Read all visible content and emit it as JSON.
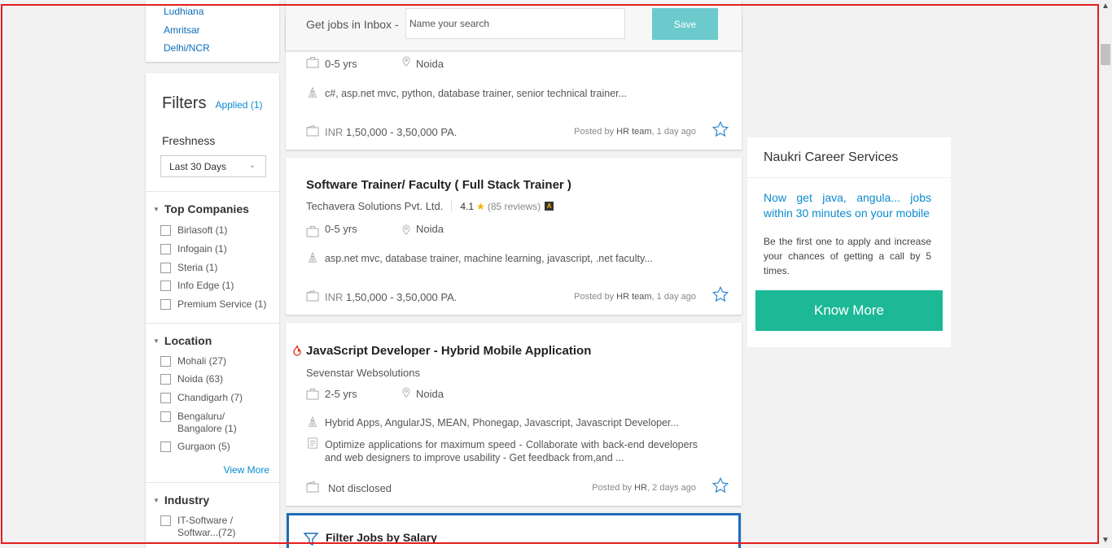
{
  "cities": [
    "Ludhiana",
    "Amritsar",
    "Delhi/NCR"
  ],
  "filters": {
    "title": "Filters",
    "applied": "Applied (1)",
    "freshness_label": "Freshness",
    "freshness_value": "Last 30 Days",
    "top_companies": {
      "title": "Top Companies",
      "options": [
        "Birlasoft (1)",
        "Infogain (1)",
        "Steria (1)",
        "Info Edge (1)",
        "Premium Service (1)"
      ]
    },
    "location": {
      "title": "Location",
      "options": [
        "Mohali (27)",
        "Noida (63)",
        "Chandigarh (7)",
        "Bengaluru/\nBangalore (1)",
        "Gurgaon (5)"
      ],
      "view_more": "View More"
    },
    "industry": {
      "title": "Industry",
      "options": [
        "IT-Software /\nSoftwar...(72)"
      ]
    }
  },
  "inbox": {
    "label": "Get jobs in Inbox -",
    "placeholder": "Name your search",
    "save": "Save"
  },
  "jobs": [
    {
      "title": "",
      "company": "",
      "experience": "0-5 yrs",
      "location": "Noida",
      "skills": "c#, asp.net mvc, python, database trainer, senior technical trainer...",
      "salary_currency": "INR",
      "salary": "1,50,000 - 3,50,000 PA.",
      "posted_prefix": "Posted by",
      "posted_by": "HR team",
      "posted_when": ", 1 day ago"
    },
    {
      "title": "Software Trainer/ Faculty ( Full Stack Trainer )",
      "company": "Techavera Solutions Pvt. Ltd.",
      "rating": "4.1",
      "reviews": "(85 reviews)",
      "badge": "A",
      "experience": "0-5 yrs",
      "location": "Noida",
      "skills": "asp.net mvc, database trainer, machine learning, javascript, .net faculty...",
      "salary_currency": "INR",
      "salary": "1,50,000 - 3,50,000 PA.",
      "posted_prefix": "Posted by",
      "posted_by": "HR team",
      "posted_when": ", 1 day ago"
    },
    {
      "title": "JavaScript Developer - Hybrid Mobile Application",
      "company": "Sevenstar Websolutions",
      "experience": "2-5 yrs",
      "location": "Noida",
      "skills": "Hybrid Apps, AngularJS, MEAN, Phonegap, Javascript, Javascript Developer...",
      "description": "Optimize applications for maximum speed - Collaborate with back-end developers and web designers to improve usability - Get feedback from,and ...",
      "salary": "Not disclosed",
      "posted_prefix": "Posted by",
      "posted_by": "HR",
      "posted_when": ", 2 days ago"
    }
  ],
  "salary_filter": {
    "title": "Filter Jobs by Salary"
  },
  "career": {
    "title": "Naukri Career Services",
    "tagline": "Now get java, angula... jobs within 30 minutes on your mobile",
    "text": "Be the first one to apply and increase your chances of getting a call by 5 times.",
    "button": "Know More"
  },
  "colors": {
    "link": "#0b6ebd",
    "save_button": "#6ccacd",
    "know_more": "#1db896",
    "salary_filter_border": "#1f6bb8",
    "frame": "#e41e1e"
  }
}
